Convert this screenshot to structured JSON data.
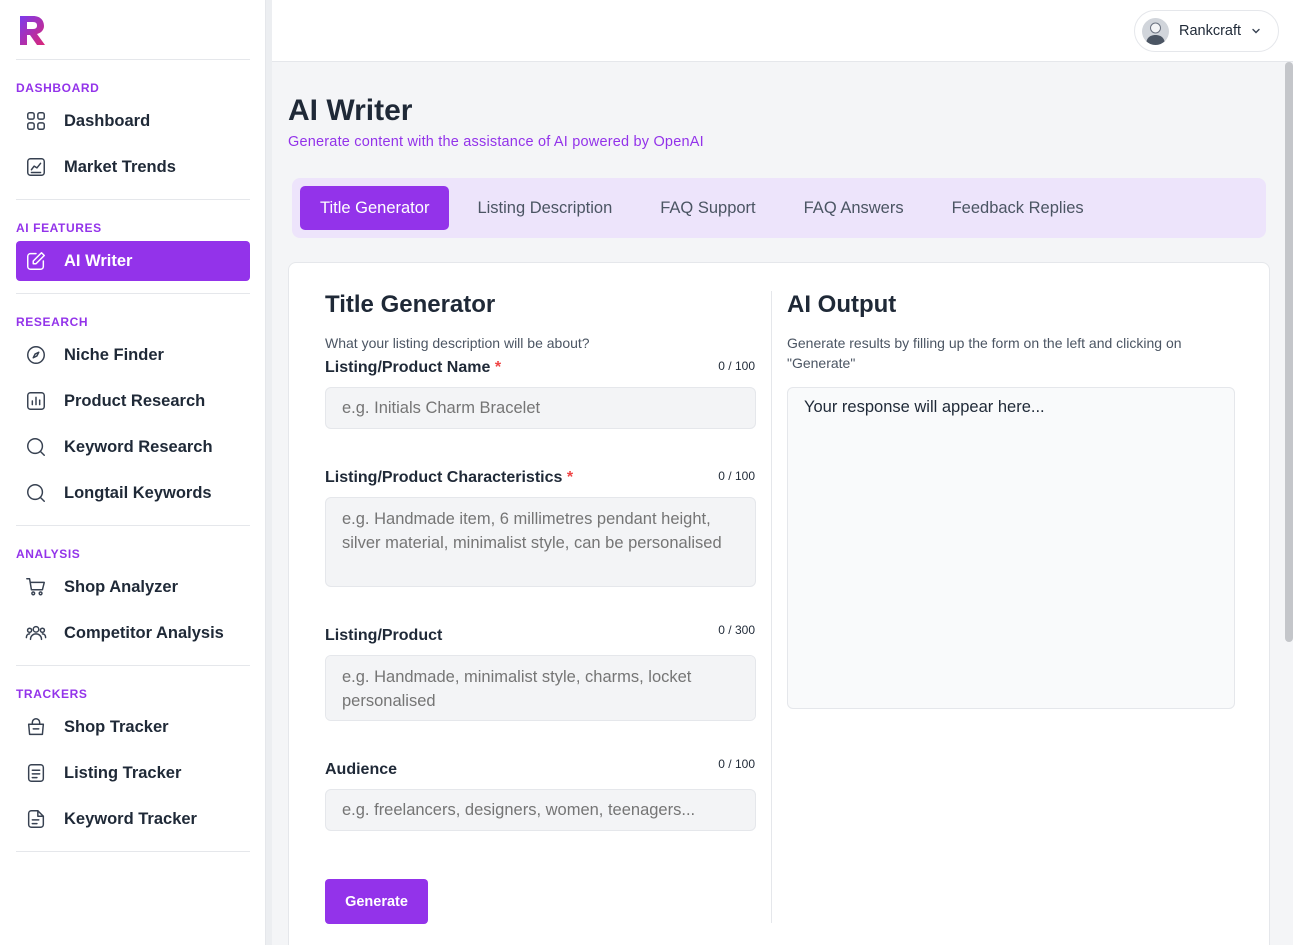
{
  "brand": {
    "logo_color": "#c026d3"
  },
  "sidebar": {
    "sections": [
      {
        "title": "DASHBOARD",
        "items": [
          {
            "label": "Dashboard",
            "icon": "grid-icon"
          },
          {
            "label": "Market Trends",
            "icon": "trend-chart-icon"
          }
        ]
      },
      {
        "title": "AI FEATURES",
        "items": [
          {
            "label": "AI Writer",
            "icon": "edit-icon",
            "active": true
          }
        ]
      },
      {
        "title": "RESEARCH",
        "items": [
          {
            "label": "Niche Finder",
            "icon": "compass-icon"
          },
          {
            "label": "Product Research",
            "icon": "bar-chart-icon"
          },
          {
            "label": "Keyword Research",
            "icon": "search-icon"
          },
          {
            "label": "Longtail Keywords",
            "icon": "search-icon"
          }
        ]
      },
      {
        "title": "ANALYSIS",
        "items": [
          {
            "label": "Shop Analyzer",
            "icon": "cart-icon"
          },
          {
            "label": "Competitor Analysis",
            "icon": "users-icon"
          }
        ]
      },
      {
        "title": "TRACKERS",
        "items": [
          {
            "label": "Shop Tracker",
            "icon": "bag-icon"
          },
          {
            "label": "Listing Tracker",
            "icon": "list-icon"
          },
          {
            "label": "Keyword Tracker",
            "icon": "doc-icon"
          }
        ]
      }
    ]
  },
  "topbar": {
    "user_name": "Rankcraft"
  },
  "page": {
    "title": "AI Writer",
    "subtitle": "Generate content with the assistance of AI powered by OpenAI"
  },
  "tabs": [
    {
      "label": "Title Generator",
      "active": true
    },
    {
      "label": "Listing Description"
    },
    {
      "label": "FAQ Support"
    },
    {
      "label": "FAQ Answers"
    },
    {
      "label": "Feedback Replies"
    }
  ],
  "form": {
    "heading": "Title Generator",
    "hint": "What your listing description will be about?",
    "fields": {
      "name": {
        "label": "Listing/Product Name",
        "required": "*",
        "counter": "0 / 100",
        "placeholder": "e.g. Initials Charm Bracelet"
      },
      "characteristics": {
        "label": "Listing/Product Characteristics",
        "required": "*",
        "counter": "0 / 100",
        "placeholder": "e.g. Handmade item, 6 millimetres pendant height, silver material, minimalist style, can be personalised"
      },
      "product": {
        "label": "Listing/Product",
        "counter": "0 / 300",
        "placeholder": "e.g. Handmade, minimalist style, charms, locket personalised"
      },
      "audience": {
        "label": "Audience",
        "counter": "0 / 100",
        "placeholder": "e.g. freelancers, designers, women, teenagers..."
      }
    },
    "generate_label": "Generate"
  },
  "output": {
    "heading": "AI Output",
    "hint": "Generate results by filling up the form on the left and clicking on \"Generate\"",
    "placeholder": "Your response will appear here..."
  },
  "colors": {
    "accent": "#9333ea",
    "tab_bg": "#ede4fb",
    "required": "#ef4444"
  }
}
